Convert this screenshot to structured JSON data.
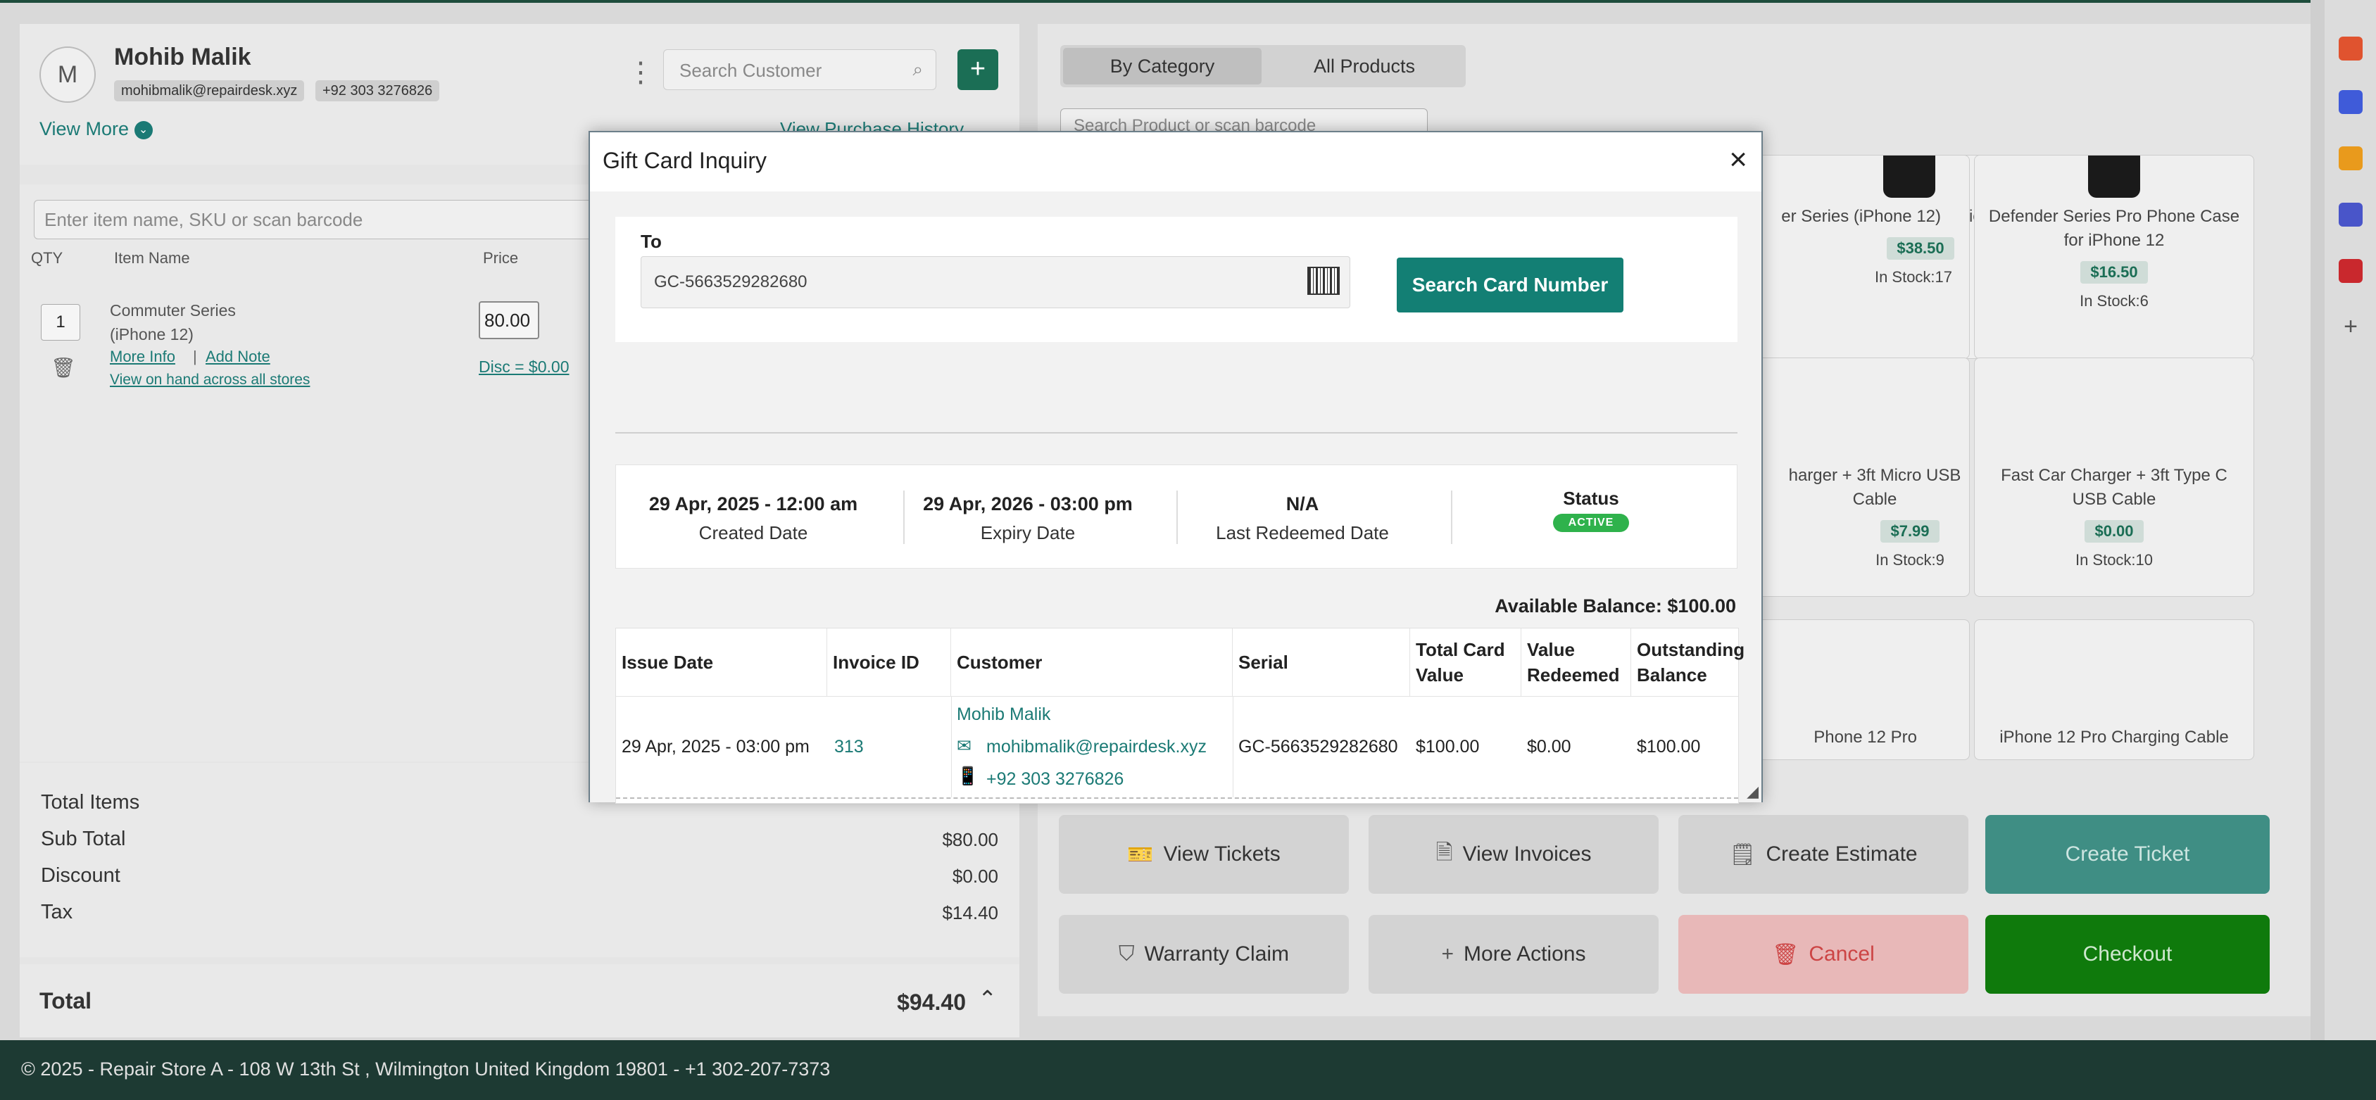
{
  "customer": {
    "initial": "M",
    "name": "Mohib Malik",
    "email": "mohibmalik@repairdesk.xyz",
    "phone": "+92 303 3276826",
    "view_more": "View More",
    "purchase_history": "View Purchase History",
    "search_placeholder": "Search Customer"
  },
  "cart": {
    "item_search_placeholder": "Enter item name, SKU or scan barcode",
    "columns": [
      "QTY",
      "Item Name",
      "Price"
    ],
    "item": {
      "qty": "1",
      "name_line1": "Commuter Series",
      "name_line2": "(iPhone 12)",
      "more_info": "More Info",
      "add_note": "Add Note",
      "view_on_hand": "View on hand across all stores",
      "price": "80.00",
      "discount": "Disc = $0.00"
    }
  },
  "totals": {
    "total_items_label": "Total Items",
    "sub_total_label": "Sub Total",
    "sub_total": "$80.00",
    "discount_label": "Discount",
    "discount": "$0.00",
    "tax_label": "Tax",
    "tax": "$14.40",
    "total_label": "Total",
    "total": "$94.40"
  },
  "products": {
    "tabs": [
      "By Category",
      "All Products"
    ],
    "search_placeholder": "Search Product or scan barcode",
    "items": [
      {
        "title": "er Series (iPhone 12)",
        "price": "$38.50",
        "stock": "In Stock:17"
      },
      {
        "title": "Defender Series Pro Phone Case for iPhone 12",
        "price": "$16.50",
        "stock": "In Stock:6"
      },
      {
        "title": "harger + 3ft Micro USB Cable",
        "price": "$7.99",
        "stock": "In Stock:9"
      },
      {
        "title": "Fast Car Charger + 3ft Type C USB Cable",
        "price": "$0.00",
        "stock": "In Stock:10"
      },
      {
        "title": "Phone 12 Pro",
        "price": "",
        "stock": ""
      },
      {
        "title": "iPhone 12 Pro Charging Cable",
        "price": "",
        "stock": ""
      }
    ]
  },
  "actions": {
    "view_tickets": "View Tickets",
    "view_invoices": "View Invoices",
    "create_estimate": "Create Estimate",
    "create_ticket": "Create Ticket",
    "warranty_claim": "Warranty Claim",
    "more_actions": "More Actions",
    "cancel": "Cancel",
    "checkout": "Checkout"
  },
  "footer": {
    "text": "© 2025 - Repair Store A - 108 W 13th St , Wilmington United Kingdom 19801 - +1 302-207-7373"
  },
  "modal": {
    "title": "Gift Card Inquiry",
    "close": "×",
    "to_label": "To",
    "card_number": "GC-5663529282680",
    "search_button": "Search Card Number",
    "created_date": "29 Apr, 2025 - 12:00 am",
    "created_label": "Created Date",
    "expiry_date": "29 Apr, 2026 - 03:00 pm",
    "expiry_label": "Expiry Date",
    "last_redeemed": "N/A",
    "last_redeemed_label": "Last Redeemed Date",
    "status_label": "Status",
    "status": "ACTIVE",
    "available_balance": "Available Balance: $100.00",
    "table": {
      "headers": [
        "Issue Date",
        "Invoice ID",
        "Customer",
        "Serial",
        "Total Card Value",
        "Value Redeemed",
        "Outstanding Balance"
      ],
      "row": {
        "issue_date": "29 Apr, 2025 - 03:00 pm",
        "invoice_id": "313",
        "customer_name": "Mohib Malik",
        "customer_email": "mohibmalik@repairdesk.xyz",
        "customer_phone": "+92 303 3276826",
        "serial": "GC-5663529282680",
        "total_value": "$100.00",
        "redeemed": "$0.00",
        "outstanding": "$100.00"
      }
    }
  },
  "colors": {
    "accent": "#137f74",
    "active": "#2fb24c",
    "checkout": "#0f7a0c",
    "footer": "#1d3a33"
  }
}
